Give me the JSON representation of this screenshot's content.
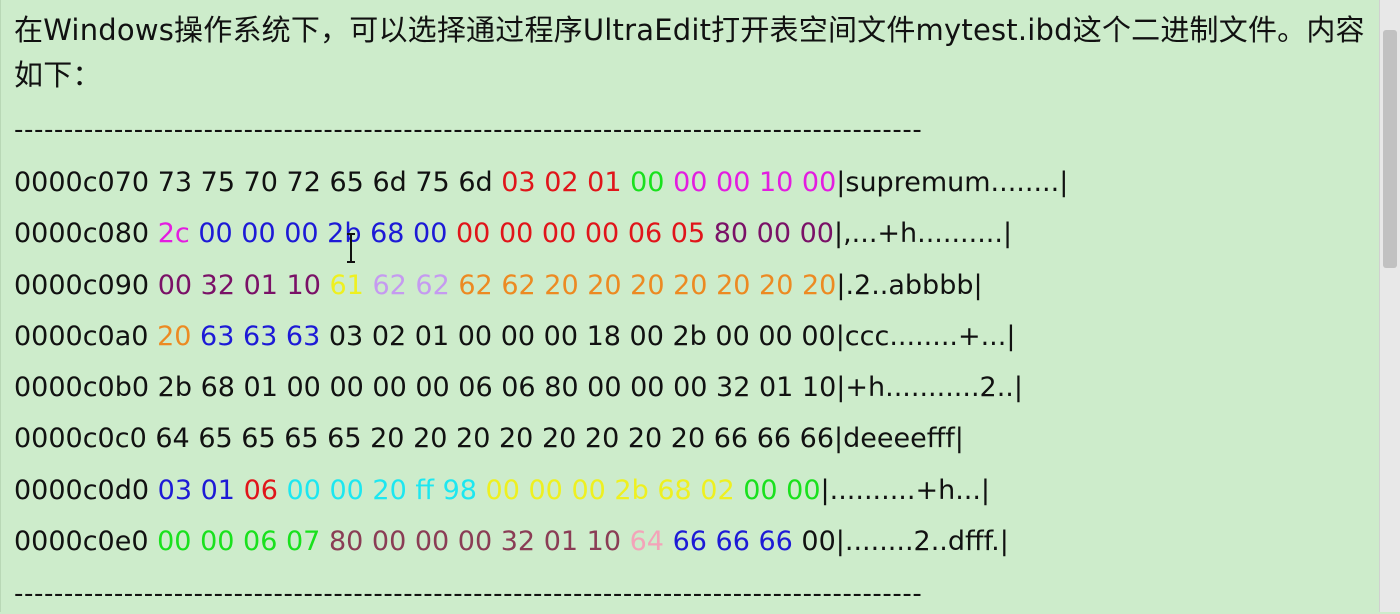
{
  "intro_text": "在Windows操作系统下，可以选择通过程序UltraEdit打开表空间文件mytest.ibd这个二进制文件。内容如下：",
  "divider_text": "-------------------------------------------------------------------------------------------",
  "colors": {
    "black": "#111111",
    "red": "#e0151a",
    "green": "#19e11d",
    "magenta": "#e31ce0",
    "blue": "#1d1ad6",
    "purple": "#7a1167",
    "yellow": "#eef020",
    "lavender": "#c59af0",
    "orange": "#ec8a22",
    "cyan": "#1de7f0",
    "maroon": "#8a3d55",
    "pink": "#f3a4b9",
    "background": "#cdeccb"
  },
  "hex_rows": [
    {
      "offset": "0000c070",
      "bytes": [
        {
          "b": "73",
          "c": "black"
        },
        {
          "b": "75",
          "c": "black"
        },
        {
          "b": "70",
          "c": "black"
        },
        {
          "b": "72",
          "c": "black"
        },
        {
          "b": "65",
          "c": "black"
        },
        {
          "b": "6d",
          "c": "black"
        },
        {
          "b": "75",
          "c": "black"
        },
        {
          "b": "6d",
          "c": "black"
        },
        {
          "b": "03",
          "c": "red"
        },
        {
          "b": "02",
          "c": "red"
        },
        {
          "b": "01",
          "c": "red"
        },
        {
          "b": "00",
          "c": "green"
        },
        {
          "b": "00",
          "c": "magenta"
        },
        {
          "b": "00",
          "c": "magenta"
        },
        {
          "b": "10",
          "c": "magenta"
        },
        {
          "b": "00",
          "c": "magenta"
        }
      ],
      "ascii": "|supremum........|"
    },
    {
      "offset": "0000c080",
      "bytes": [
        {
          "b": "2c",
          "c": "magenta"
        },
        {
          "b": "00",
          "c": "blue"
        },
        {
          "b": "00",
          "c": "blue"
        },
        {
          "b": "00",
          "c": "blue"
        },
        {
          "b": "2b",
          "c": "blue"
        },
        {
          "b": "68",
          "c": "blue"
        },
        {
          "b": "00",
          "c": "blue"
        },
        {
          "b": "00",
          "c": "red"
        },
        {
          "b": "00",
          "c": "red"
        },
        {
          "b": "00",
          "c": "red"
        },
        {
          "b": "00",
          "c": "red"
        },
        {
          "b": "06",
          "c": "red"
        },
        {
          "b": "05",
          "c": "red"
        },
        {
          "b": "80",
          "c": "purple"
        },
        {
          "b": "00",
          "c": "purple"
        },
        {
          "b": "00",
          "c": "purple"
        }
      ],
      "ascii": "|,...+h..........|"
    },
    {
      "offset": "0000c090",
      "bytes": [
        {
          "b": "00",
          "c": "purple"
        },
        {
          "b": "32",
          "c": "purple"
        },
        {
          "b": "01",
          "c": "purple"
        },
        {
          "b": "10",
          "c": "purple"
        },
        {
          "b": "61",
          "c": "yellow"
        },
        {
          "b": "62",
          "c": "lavender"
        },
        {
          "b": "62",
          "c": "lavender"
        },
        {
          "b": "62",
          "c": "orange"
        },
        {
          "b": "62",
          "c": "orange"
        },
        {
          "b": "20",
          "c": "orange"
        },
        {
          "b": "20",
          "c": "orange"
        },
        {
          "b": "20",
          "c": "orange"
        },
        {
          "b": "20",
          "c": "orange"
        },
        {
          "b": "20",
          "c": "orange"
        },
        {
          "b": "20",
          "c": "orange"
        },
        {
          "b": "20",
          "c": "orange"
        }
      ],
      "ascii": "|.2..abbbb|"
    },
    {
      "offset": "0000c0a0",
      "bytes": [
        {
          "b": "20",
          "c": "orange"
        },
        {
          "b": "63",
          "c": "blue"
        },
        {
          "b": "63",
          "c": "blue"
        },
        {
          "b": "63",
          "c": "blue"
        },
        {
          "b": "03",
          "c": "black"
        },
        {
          "b": "02",
          "c": "black"
        },
        {
          "b": "01",
          "c": "black"
        },
        {
          "b": "00",
          "c": "black"
        },
        {
          "b": "00",
          "c": "black"
        },
        {
          "b": "00",
          "c": "black"
        },
        {
          "b": "18",
          "c": "black"
        },
        {
          "b": "00",
          "c": "black"
        },
        {
          "b": "2b",
          "c": "black"
        },
        {
          "b": "00",
          "c": "black"
        },
        {
          "b": "00",
          "c": "black"
        },
        {
          "b": "00",
          "c": "black"
        }
      ],
      "ascii": "|ccc........+...|"
    },
    {
      "offset": "0000c0b0",
      "bytes": [
        {
          "b": "2b",
          "c": "black"
        },
        {
          "b": "68",
          "c": "black"
        },
        {
          "b": "01",
          "c": "black"
        },
        {
          "b": "00",
          "c": "black"
        },
        {
          "b": "00",
          "c": "black"
        },
        {
          "b": "00",
          "c": "black"
        },
        {
          "b": "00",
          "c": "black"
        },
        {
          "b": "06",
          "c": "black"
        },
        {
          "b": "06",
          "c": "black"
        },
        {
          "b": "80",
          "c": "black"
        },
        {
          "b": "00",
          "c": "black"
        },
        {
          "b": "00",
          "c": "black"
        },
        {
          "b": "00",
          "c": "black"
        },
        {
          "b": "32",
          "c": "black"
        },
        {
          "b": "01",
          "c": "black"
        },
        {
          "b": "10",
          "c": "black"
        }
      ],
      "ascii": "|+h...........2..|"
    },
    {
      "offset": "0000c0c0",
      "bytes": [
        {
          "b": "64",
          "c": "black"
        },
        {
          "b": "65",
          "c": "black"
        },
        {
          "b": "65",
          "c": "black"
        },
        {
          "b": "65",
          "c": "black"
        },
        {
          "b": "65",
          "c": "black"
        },
        {
          "b": "20",
          "c": "black"
        },
        {
          "b": "20",
          "c": "black"
        },
        {
          "b": "20",
          "c": "black"
        },
        {
          "b": "20",
          "c": "black"
        },
        {
          "b": "20",
          "c": "black"
        },
        {
          "b": "20",
          "c": "black"
        },
        {
          "b": "20",
          "c": "black"
        },
        {
          "b": "20",
          "c": "black"
        },
        {
          "b": "66",
          "c": "black"
        },
        {
          "b": "66",
          "c": "black"
        },
        {
          "b": "66",
          "c": "black"
        }
      ],
      "ascii": "|deeeefff|"
    },
    {
      "offset": "0000c0d0",
      "bytes": [
        {
          "b": "03",
          "c": "blue"
        },
        {
          "b": "01",
          "c": "blue"
        },
        {
          "b": "06",
          "c": "red"
        },
        {
          "b": "00",
          "c": "cyan"
        },
        {
          "b": "00",
          "c": "cyan"
        },
        {
          "b": "20",
          "c": "cyan"
        },
        {
          "b": "ff",
          "c": "cyan"
        },
        {
          "b": "98",
          "c": "cyan"
        },
        {
          "b": "00",
          "c": "yellow"
        },
        {
          "b": "00",
          "c": "yellow"
        },
        {
          "b": "00",
          "c": "yellow"
        },
        {
          "b": "2b",
          "c": "yellow"
        },
        {
          "b": "68",
          "c": "yellow"
        },
        {
          "b": "02",
          "c": "yellow"
        },
        {
          "b": "00",
          "c": "green"
        },
        {
          "b": "00",
          "c": "green"
        }
      ],
      "ascii": "|..........+h...|"
    },
    {
      "offset": "0000c0e0",
      "bytes": [
        {
          "b": "00",
          "c": "green"
        },
        {
          "b": "00",
          "c": "green"
        },
        {
          "b": "06",
          "c": "green"
        },
        {
          "b": "07",
          "c": "green"
        },
        {
          "b": "80",
          "c": "maroon"
        },
        {
          "b": "00",
          "c": "maroon"
        },
        {
          "b": "00",
          "c": "maroon"
        },
        {
          "b": "00",
          "c": "maroon"
        },
        {
          "b": "32",
          "c": "maroon"
        },
        {
          "b": "01",
          "c": "maroon"
        },
        {
          "b": "10",
          "c": "maroon"
        },
        {
          "b": "64",
          "c": "pink"
        },
        {
          "b": "66",
          "c": "blue"
        },
        {
          "b": "66",
          "c": "blue"
        },
        {
          "b": "66",
          "c": "blue"
        },
        {
          "b": "00",
          "c": "black"
        }
      ],
      "ascii": "|........2..dfff.|"
    }
  ]
}
